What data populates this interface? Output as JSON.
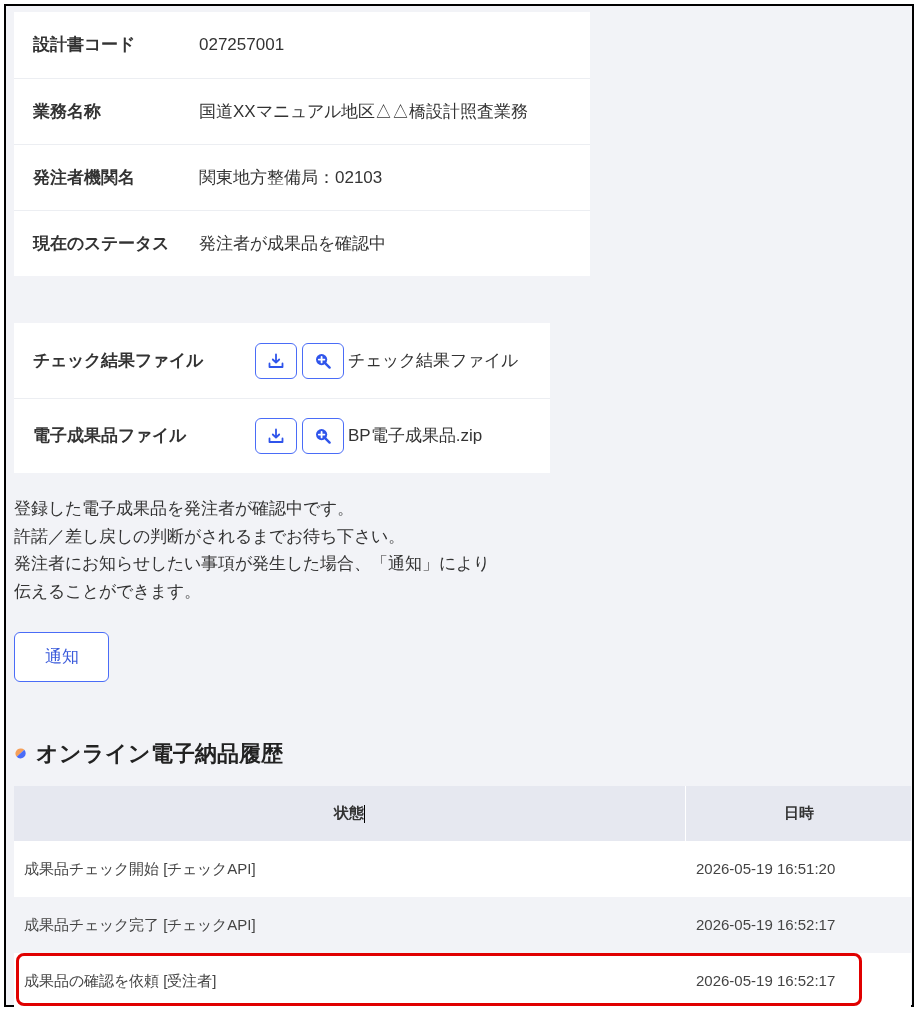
{
  "info": [
    {
      "label": "設計書コード",
      "value": "027257001"
    },
    {
      "label": "業務名称",
      "value": "国道XXマニュアル地区△△橋設計照査業務"
    },
    {
      "label": "発注者機関名",
      "value": "関東地方整備局：02103"
    },
    {
      "label": "現在のステータス",
      "value": "発注者が成果品を確認中"
    }
  ],
  "files": [
    {
      "label": "チェック結果ファイル",
      "file_name": "チェック結果ファイル"
    },
    {
      "label": "電子成果品ファイル",
      "file_name": "BP電子成果品.zip"
    }
  ],
  "message": [
    "登録した電子成果品を発注者が確認中です。",
    "許諾／差し戻しの判断がされるまでお待ち下さい。",
    "発注者にお知らせしたい事項が発生した場合、「通知」により",
    "伝えることができます。"
  ],
  "notify_button": "通知",
  "history": {
    "title": "オンライン電子納品履歴",
    "columns": [
      "状態",
      "日時"
    ],
    "rows": [
      {
        "status": "成果品チェック開始 [チェックAPI]",
        "datetime": "2026-05-19 16:51:20",
        "highlighted": false
      },
      {
        "status": "成果品チェック完了 [チェックAPI]",
        "datetime": "2026-05-19 16:52:17",
        "highlighted": false
      },
      {
        "status": "成果品の確認を依頼 [受注者]",
        "datetime": "2026-05-19 16:52:17",
        "highlighted": true
      }
    ]
  }
}
